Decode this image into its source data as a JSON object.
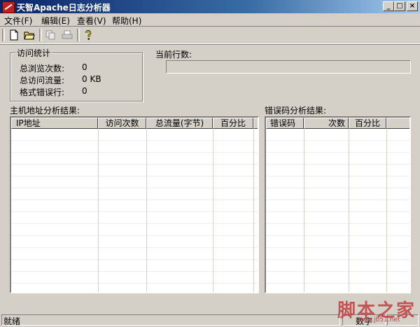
{
  "window": {
    "title": "天智Apache日志分析器",
    "min_glyph": "_",
    "max_glyph": "□",
    "close_glyph": "×"
  },
  "menubar": {
    "items": [
      "文件(F)",
      "编辑(E)",
      "查看(V)",
      "帮助(H)"
    ]
  },
  "toolbar": {
    "icons": [
      "new-file-icon",
      "open-folder-icon",
      "copy-icon",
      "print-icon",
      "help-icon"
    ]
  },
  "stats": {
    "group_label": "访问统计",
    "rows": [
      {
        "label": "总浏览次数:",
        "value": "0"
      },
      {
        "label": "总访问流量:",
        "value": "0 KB"
      },
      {
        "label": "格式错误行:",
        "value": "0"
      }
    ]
  },
  "current_line": {
    "label": "当前行数:"
  },
  "host_results": {
    "label": "主机地址分析结果:",
    "columns": [
      "IP地址",
      "访问次数",
      "总流量(字节)",
      "百分比"
    ],
    "rows": []
  },
  "error_results": {
    "label": "错误码分析结果:",
    "columns": [
      "错误码",
      "次数",
      "百分比"
    ],
    "rows": []
  },
  "statusbar": {
    "text": "就绪",
    "pane2": "数字"
  },
  "watermark": {
    "text": "脚本之家",
    "url": "www.jb51.net"
  }
}
